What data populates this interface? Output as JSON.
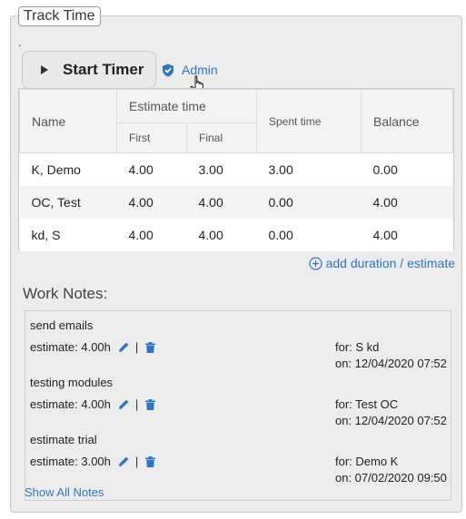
{
  "panel": {
    "title": "Track Time",
    "dot": "."
  },
  "timer": {
    "start_label": "Start Timer",
    "admin_label": "Admin"
  },
  "grid": {
    "headers": {
      "name": "Name",
      "estimate": "Estimate time",
      "first": "First",
      "final": "Final",
      "spent": "Spent time",
      "balance": "Balance"
    },
    "rows": [
      {
        "name": "K, Demo",
        "first": "4.00",
        "final": "3.00",
        "spent": "3.00",
        "balance": "0.00"
      },
      {
        "name": "OC, Test",
        "first": "4.00",
        "final": "4.00",
        "spent": "0.00",
        "balance": "4.00"
      },
      {
        "name": "kd, S",
        "first": "4.00",
        "final": "4.00",
        "spent": "0.00",
        "balance": "4.00"
      }
    ]
  },
  "add_duration": "add duration / estimate",
  "work_notes": {
    "title": "Work Notes:",
    "notes": [
      {
        "title": "send emails",
        "estimate": "estimate: 4.00h",
        "for": "for: S kd",
        "on": "on: 12/04/2020 07:52"
      },
      {
        "title": "testing modules",
        "estimate": "estimate: 4.00h",
        "for": "for: Test OC",
        "on": "on: 12/04/2020 07:52"
      },
      {
        "title": "estimate trial",
        "estimate": "estimate: 3.00h",
        "for": "for: Demo K",
        "on": "on: 07/02/2020 09:50"
      }
    ],
    "separator": "|",
    "show_all": "Show All Notes"
  },
  "icons": {
    "play": "play-icon",
    "admin": "shield-check-icon",
    "add": "plus-circle-icon",
    "edit": "pencil-icon",
    "delete": "trash-icon",
    "cursor": "hand-pointer-icon"
  },
  "colors": {
    "link": "#2e75c8",
    "panel_bg": "#ececec",
    "header_bg": "#f3f3f3"
  }
}
